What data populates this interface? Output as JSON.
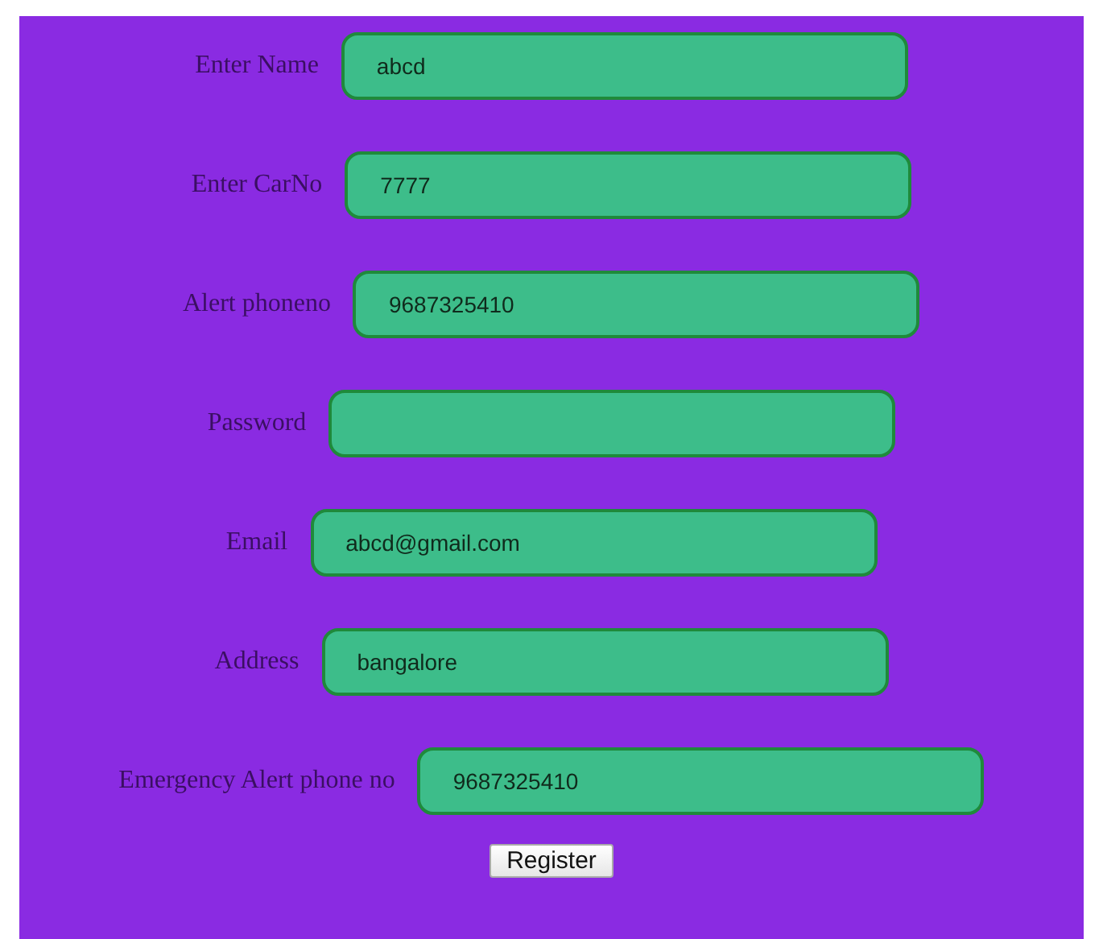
{
  "fields": [
    {
      "label": "Enter Name",
      "value": "abcd"
    },
    {
      "label": "Enter CarNo",
      "value": "7777"
    },
    {
      "label": "Alert phoneno",
      "value": "9687325410"
    },
    {
      "label": "Password"
    },
    {
      "label": "Email",
      "value": "abcd@gmail.com"
    },
    {
      "label": "Address",
      "value": "bangalore"
    },
    {
      "label": "Emergency Alert phone no",
      "value": "9687325410"
    }
  ],
  "submit_button": "Register"
}
